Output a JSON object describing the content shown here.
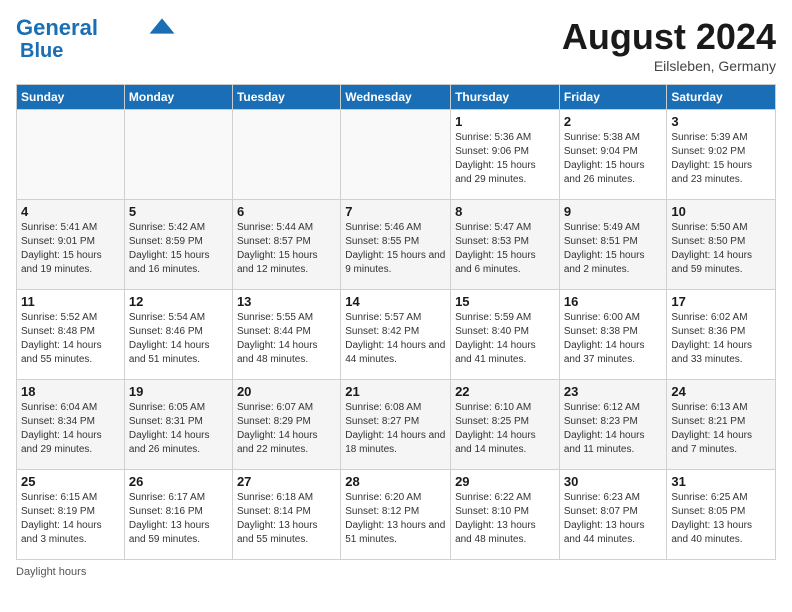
{
  "header": {
    "logo_line1": "General",
    "logo_line2": "Blue",
    "month_title": "August 2024",
    "location": "Eilsleben, Germany"
  },
  "days_of_week": [
    "Sunday",
    "Monday",
    "Tuesday",
    "Wednesday",
    "Thursday",
    "Friday",
    "Saturday"
  ],
  "weeks": [
    [
      {
        "day": "",
        "info": ""
      },
      {
        "day": "",
        "info": ""
      },
      {
        "day": "",
        "info": ""
      },
      {
        "day": "",
        "info": ""
      },
      {
        "day": "1",
        "info": "Sunrise: 5:36 AM\nSunset: 9:06 PM\nDaylight: 15 hours and 29 minutes."
      },
      {
        "day": "2",
        "info": "Sunrise: 5:38 AM\nSunset: 9:04 PM\nDaylight: 15 hours and 26 minutes."
      },
      {
        "day": "3",
        "info": "Sunrise: 5:39 AM\nSunset: 9:02 PM\nDaylight: 15 hours and 23 minutes."
      }
    ],
    [
      {
        "day": "4",
        "info": "Sunrise: 5:41 AM\nSunset: 9:01 PM\nDaylight: 15 hours and 19 minutes."
      },
      {
        "day": "5",
        "info": "Sunrise: 5:42 AM\nSunset: 8:59 PM\nDaylight: 15 hours and 16 minutes."
      },
      {
        "day": "6",
        "info": "Sunrise: 5:44 AM\nSunset: 8:57 PM\nDaylight: 15 hours and 12 minutes."
      },
      {
        "day": "7",
        "info": "Sunrise: 5:46 AM\nSunset: 8:55 PM\nDaylight: 15 hours and 9 minutes."
      },
      {
        "day": "8",
        "info": "Sunrise: 5:47 AM\nSunset: 8:53 PM\nDaylight: 15 hours and 6 minutes."
      },
      {
        "day": "9",
        "info": "Sunrise: 5:49 AM\nSunset: 8:51 PM\nDaylight: 15 hours and 2 minutes."
      },
      {
        "day": "10",
        "info": "Sunrise: 5:50 AM\nSunset: 8:50 PM\nDaylight: 14 hours and 59 minutes."
      }
    ],
    [
      {
        "day": "11",
        "info": "Sunrise: 5:52 AM\nSunset: 8:48 PM\nDaylight: 14 hours and 55 minutes."
      },
      {
        "day": "12",
        "info": "Sunrise: 5:54 AM\nSunset: 8:46 PM\nDaylight: 14 hours and 51 minutes."
      },
      {
        "day": "13",
        "info": "Sunrise: 5:55 AM\nSunset: 8:44 PM\nDaylight: 14 hours and 48 minutes."
      },
      {
        "day": "14",
        "info": "Sunrise: 5:57 AM\nSunset: 8:42 PM\nDaylight: 14 hours and 44 minutes."
      },
      {
        "day": "15",
        "info": "Sunrise: 5:59 AM\nSunset: 8:40 PM\nDaylight: 14 hours and 41 minutes."
      },
      {
        "day": "16",
        "info": "Sunrise: 6:00 AM\nSunset: 8:38 PM\nDaylight: 14 hours and 37 minutes."
      },
      {
        "day": "17",
        "info": "Sunrise: 6:02 AM\nSunset: 8:36 PM\nDaylight: 14 hours and 33 minutes."
      }
    ],
    [
      {
        "day": "18",
        "info": "Sunrise: 6:04 AM\nSunset: 8:34 PM\nDaylight: 14 hours and 29 minutes."
      },
      {
        "day": "19",
        "info": "Sunrise: 6:05 AM\nSunset: 8:31 PM\nDaylight: 14 hours and 26 minutes."
      },
      {
        "day": "20",
        "info": "Sunrise: 6:07 AM\nSunset: 8:29 PM\nDaylight: 14 hours and 22 minutes."
      },
      {
        "day": "21",
        "info": "Sunrise: 6:08 AM\nSunset: 8:27 PM\nDaylight: 14 hours and 18 minutes."
      },
      {
        "day": "22",
        "info": "Sunrise: 6:10 AM\nSunset: 8:25 PM\nDaylight: 14 hours and 14 minutes."
      },
      {
        "day": "23",
        "info": "Sunrise: 6:12 AM\nSunset: 8:23 PM\nDaylight: 14 hours and 11 minutes."
      },
      {
        "day": "24",
        "info": "Sunrise: 6:13 AM\nSunset: 8:21 PM\nDaylight: 14 hours and 7 minutes."
      }
    ],
    [
      {
        "day": "25",
        "info": "Sunrise: 6:15 AM\nSunset: 8:19 PM\nDaylight: 14 hours and 3 minutes."
      },
      {
        "day": "26",
        "info": "Sunrise: 6:17 AM\nSunset: 8:16 PM\nDaylight: 13 hours and 59 minutes."
      },
      {
        "day": "27",
        "info": "Sunrise: 6:18 AM\nSunset: 8:14 PM\nDaylight: 13 hours and 55 minutes."
      },
      {
        "day": "28",
        "info": "Sunrise: 6:20 AM\nSunset: 8:12 PM\nDaylight: 13 hours and 51 minutes."
      },
      {
        "day": "29",
        "info": "Sunrise: 6:22 AM\nSunset: 8:10 PM\nDaylight: 13 hours and 48 minutes."
      },
      {
        "day": "30",
        "info": "Sunrise: 6:23 AM\nSunset: 8:07 PM\nDaylight: 13 hours and 44 minutes."
      },
      {
        "day": "31",
        "info": "Sunrise: 6:25 AM\nSunset: 8:05 PM\nDaylight: 13 hours and 40 minutes."
      }
    ]
  ],
  "footnote": "Daylight hours"
}
